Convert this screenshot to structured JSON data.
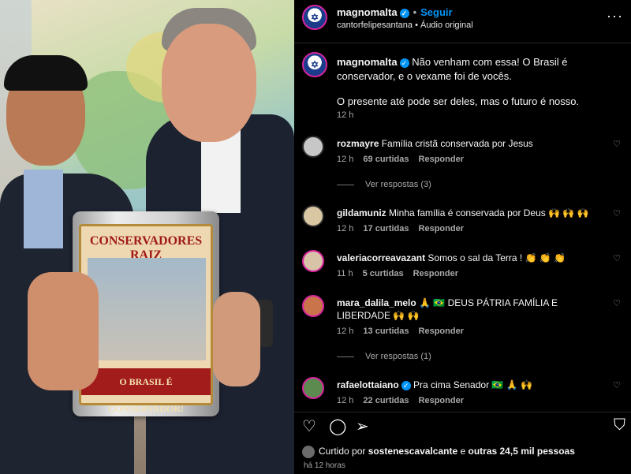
{
  "header": {
    "username": "magnomalta",
    "follow_label": "Seguir",
    "sub": "cantorfelipesantana • Áudio original",
    "more_icon": "more-horizontal-icon"
  },
  "media": {
    "can_title": "CONSERVADORES RAIZ",
    "can_banner": "O BRASIL É CONSERVADOR!"
  },
  "caption": {
    "username": "magnomalta",
    "text": "Não venham com essa! O Brasil é conservador, e o vexame foi de vocês.",
    "text2": "O presente até pode ser deles, mas o futuro é nosso.",
    "time": "12 h"
  },
  "comments": [
    {
      "user": "rozmayre",
      "text": "Família cristã conservada por Jesus",
      "time": "12 h",
      "likes": "69 curtidas",
      "reply": "Responder",
      "view_replies": "Ver respostas (3)"
    },
    {
      "user": "gildamuniz",
      "text": "Minha família é conservada por Deus 🙌 🙌 🙌",
      "time": "12 h",
      "likes": "17 curtidas",
      "reply": "Responder"
    },
    {
      "user": "valeriacorreavazant",
      "text": "Somos o sal da Terra ! 👏 👏 👏",
      "time": "11 h",
      "likes": "5 curtidas",
      "reply": "Responder"
    },
    {
      "user": "mara_dalila_melo",
      "text": "🙏 🇧🇷 DEUS PÁTRIA FAMÍLIA E LIBERDADE 🙌 🙌",
      "time": "12 h",
      "likes": "13 curtidas",
      "reply": "Responder",
      "view_replies": "Ver respostas (1)"
    },
    {
      "user": "rafaelottaiano",
      "text": "Pra cima Senador 🇧🇷 🙏 🙌",
      "time": "12 h",
      "likes": "22 curtidas",
      "reply": "Responder"
    }
  ],
  "likes": {
    "prefix": "Curtido por",
    "user": "sostenescavalcante",
    "mid": "e",
    "others": "outras 24,5 mil pessoas"
  },
  "posted": "há 12 horas",
  "colors": {
    "accent": "#0095f6",
    "background": "#000000",
    "muted": "#a8a8a8"
  }
}
